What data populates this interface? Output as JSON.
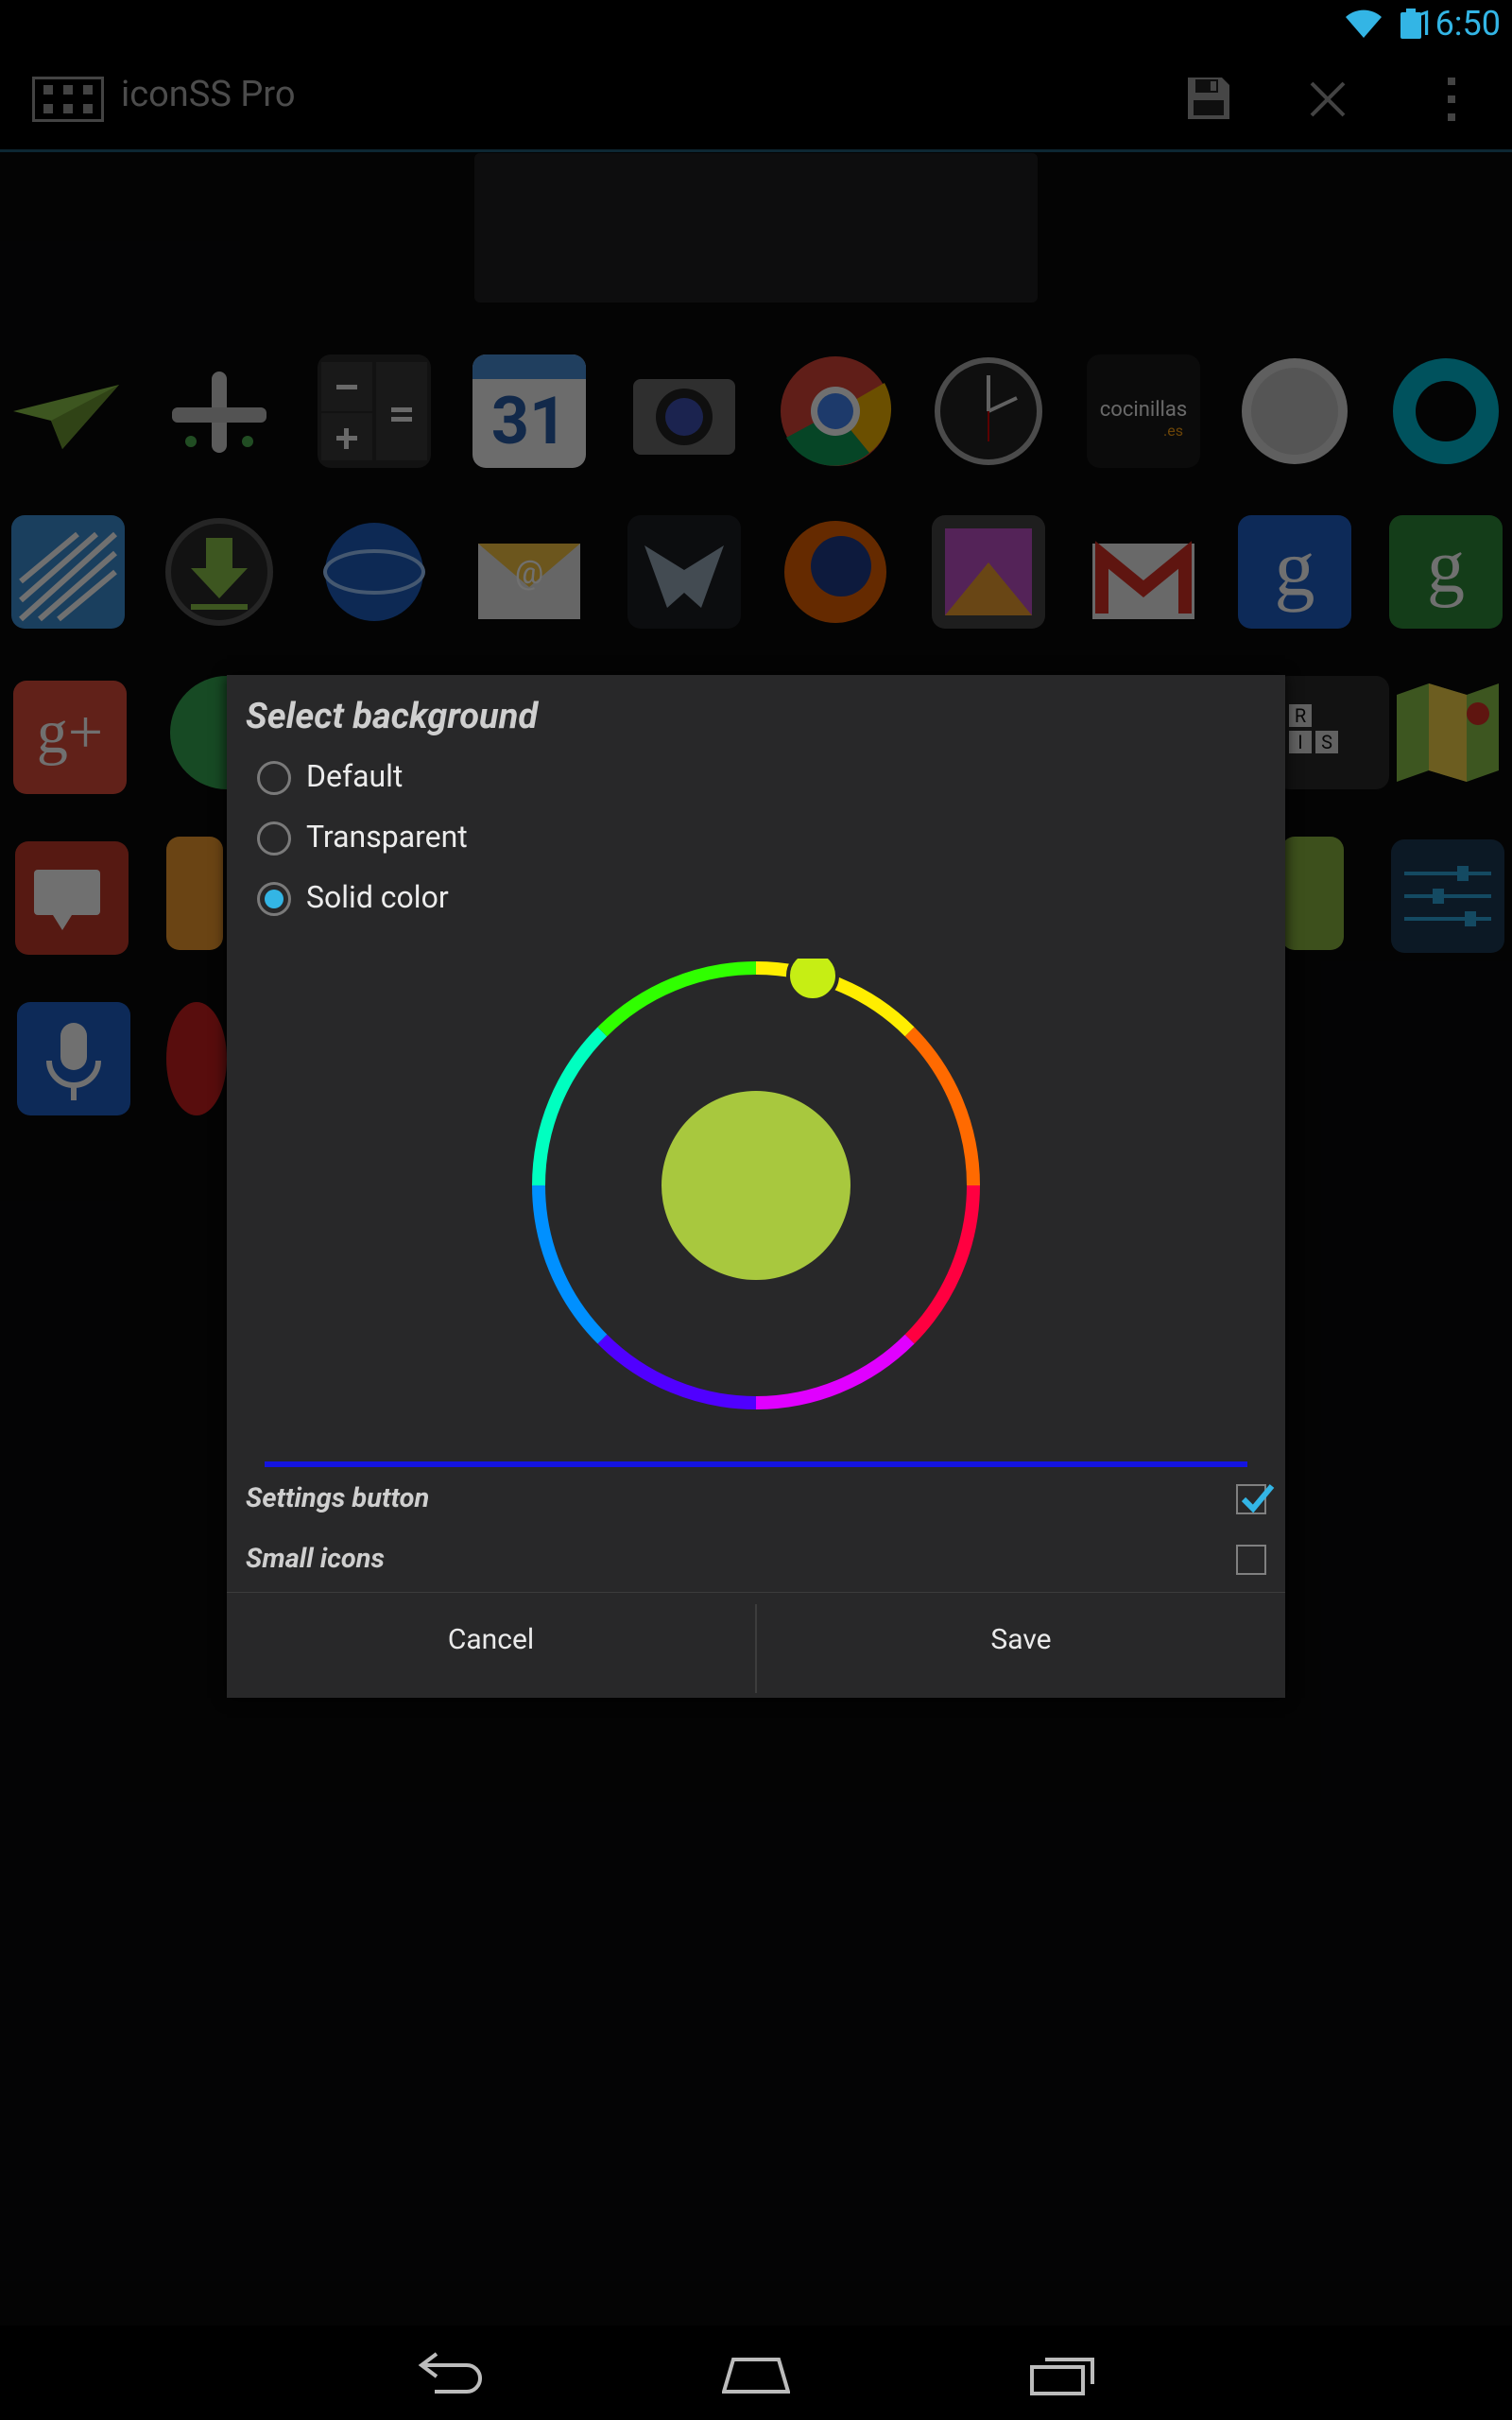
{
  "status_bar": {
    "time": "16:50",
    "wifi_icon": "wifi-icon",
    "battery_icon": "battery-icon",
    "accent_color": "#33b5e5"
  },
  "action_bar": {
    "title": "iconSS Pro",
    "app_icon": "grid-icon",
    "actions": [
      {
        "name": "save",
        "icon": "save-icon"
      },
      {
        "name": "close",
        "icon": "close-icon"
      },
      {
        "name": "overflow",
        "icon": "overflow-menu-icon"
      }
    ]
  },
  "icon_grid": {
    "icons": [
      "paper-plane-icon",
      "airplane-icon",
      "calculator-icon",
      "calendar-icon",
      "camera-icon",
      "chrome-icon",
      "clock-icon",
      "cocinillas-icon",
      "coin-icon",
      "ring-icon",
      "stripes-icon",
      "download-icon",
      "earth-icon",
      "email-icon",
      "falcon-icon",
      "firefox-icon",
      "gallery-icon",
      "gmail-icon",
      "google-icon",
      "google-settings-icon",
      "google-plus-icon",
      "hangouts-icon",
      "",
      "",
      "",
      "",
      "",
      "",
      "words-icon",
      "maps-icon",
      "messenger-icon",
      "kids-icon",
      "",
      "",
      "",
      "",
      "",
      "",
      "android-icon",
      "equalizer-icon",
      "microphone-icon",
      "popcorn-icon"
    ],
    "calendar_day": "31",
    "cocinillas_text": "cocinillas",
    "cocinillas_suffix": ".es",
    "words_tiles": [
      "R",
      "I",
      "S"
    ]
  },
  "dialog": {
    "title": "Select background",
    "options": [
      {
        "label": "Default",
        "checked": false
      },
      {
        "label": "Transparent",
        "checked": false
      },
      {
        "label": "Solid color",
        "checked": true
      }
    ],
    "color_picker": {
      "selected_color": "#a8c83e",
      "handle_color": "#c6ee14"
    },
    "checkboxes": [
      {
        "label": "Settings button",
        "checked": true
      },
      {
        "label": "Small icons",
        "checked": false
      }
    ],
    "buttons": {
      "cancel": "Cancel",
      "save": "Save"
    },
    "bar_color": "#1414e0"
  },
  "nav_bar": {
    "back_icon": "back-icon",
    "home_icon": "home-icon",
    "recents_icon": "recents-icon"
  }
}
